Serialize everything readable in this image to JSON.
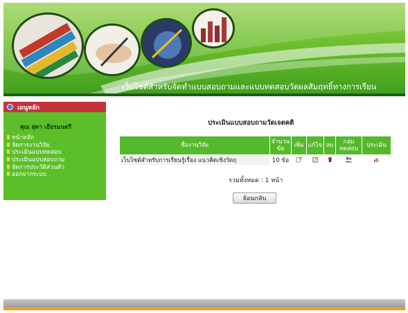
{
  "header": {
    "site_title": "เว็บไซต์สำหรับจัดทำแบบสอบถามและแบบทดสอบวัดผลสัมฤทธิ์ทางการเรียน"
  },
  "sidebar": {
    "menu_title": "เมนูหลัก",
    "user_name": "คุณ สุดา เธียรมนตรี",
    "items": [
      {
        "label": "หน้าหลัก"
      },
      {
        "label": "จัดการงานวิจัย"
      },
      {
        "label": "ประเมินแบบทดสอบ"
      },
      {
        "label": "ประเมินแบบสอบถาม"
      },
      {
        "label": "จัดการประวัติส่วนตัว"
      },
      {
        "label": "ออกจากระบบ"
      }
    ]
  },
  "main": {
    "title": "ประเมินแบบสอบถามวัดเจตคติ",
    "table": {
      "headers": {
        "name": "ชื่องานวิจัย",
        "count": "จำนวนข้อ",
        "add": "เพิ่ม",
        "edit": "แก้ไข",
        "delete": "ลบ",
        "group": "กลุ่มทดสอบ",
        "evaluate": "ประเมิน"
      },
      "rows": [
        {
          "name": "เว็บไซต์สำหรับการเรียนรู้เรื่อง แนวคิดเชิงวัตถุ",
          "count": "10 ข้อ"
        }
      ]
    },
    "total": "รวมทั้งหมด : 1 หน้า",
    "back_label": "ย้อนกลับ"
  },
  "colors": {
    "banner_green": "#6cbe2c",
    "sidebar_green": "#5cbf2a",
    "menu_head_red": "#c5323b",
    "footer_orange": "#f39c1e"
  }
}
